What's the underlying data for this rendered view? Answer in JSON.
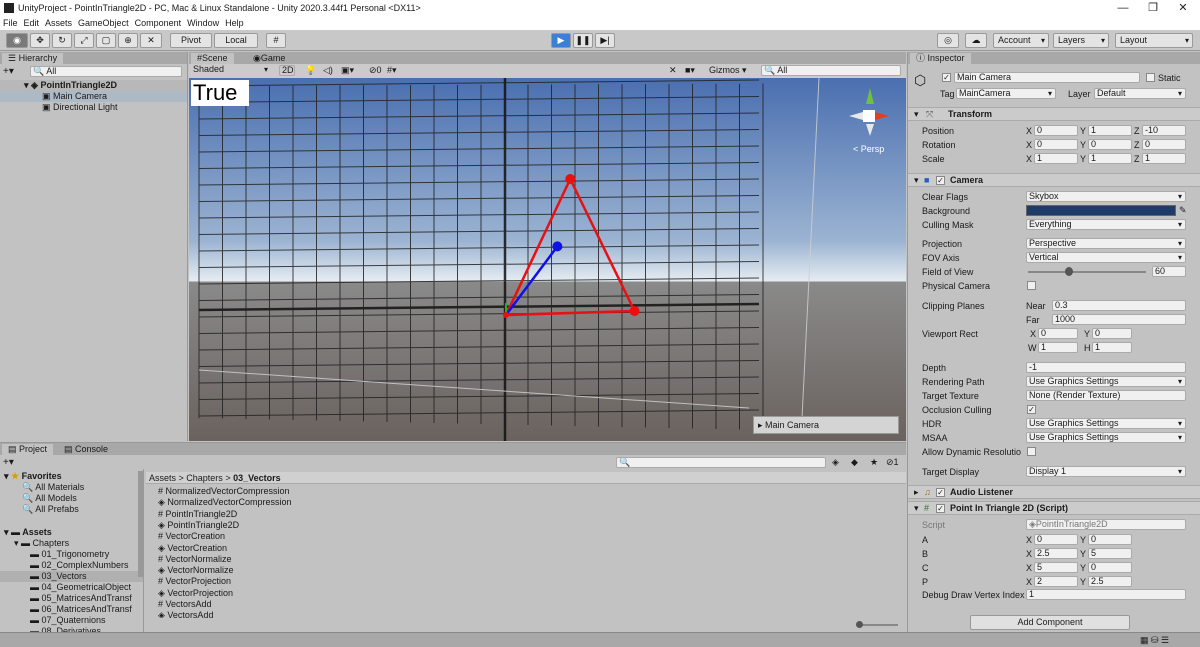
{
  "window": {
    "title": "UnityProject - PointInTriangle2D - PC, Mac & Linux Standalone - Unity 2020.3.44f1 Personal <DX11>",
    "minimize": "—",
    "maximize": "❐",
    "close": "✕"
  },
  "menu": [
    "File",
    "Edit",
    "Assets",
    "GameObject",
    "Component",
    "Window",
    "Help"
  ],
  "toolbar": {
    "pivot": "Pivot",
    "local": "Local",
    "account": "Account",
    "layers": "Layers",
    "layout": "Layout"
  },
  "hierarchy": {
    "tab": "Hierarchy",
    "search": "All",
    "scene": "PointInTriangle2D",
    "items": [
      "Main Camera",
      "Directional Light"
    ]
  },
  "scene": {
    "tabs": [
      "Scene",
      "Game"
    ],
    "shading": "Shaded",
    "mode2d": "2D",
    "fx": "0",
    "gizmos": "Gizmos",
    "search": "All",
    "overlay_text": "True",
    "persp": "< Persp",
    "camera_preview": "Main Camera"
  },
  "chart_data": {
    "type": "scatter",
    "x": [
      0,
      2.5,
      5,
      2
    ],
    "y": [
      0,
      5,
      0,
      2.5
    ],
    "points": [
      {
        "x": 0,
        "y": 0,
        "label": "A"
      },
      {
        "x": 2.5,
        "y": 5,
        "label": "B"
      },
      {
        "x": 5,
        "y": 0,
        "label": "C"
      },
      {
        "x": 2,
        "y": 2.5,
        "label": "P"
      }
    ],
    "triangle": [
      "A",
      "B",
      "C"
    ],
    "title": "",
    "xlabel": "",
    "ylabel": ""
  },
  "inspector": {
    "tab": "Inspector",
    "name": "Main Camera",
    "static": "Static",
    "tag_label": "Tag",
    "tag": "MainCamera",
    "layer_label": "Layer",
    "layer": "Default",
    "transform": {
      "title": "Transform",
      "rows": [
        {
          "label": "Position",
          "x": "0",
          "y": "1",
          "z": "-10"
        },
        {
          "label": "Rotation",
          "x": "0",
          "y": "0",
          "z": "0"
        },
        {
          "label": "Scale",
          "x": "1",
          "y": "1",
          "z": "1"
        }
      ]
    },
    "camera": {
      "title": "Camera",
      "clear_flags_label": "Clear Flags",
      "clear_flags": "Skybox",
      "background_label": "Background",
      "culling_label": "Culling Mask",
      "culling": "Everything",
      "projection_label": "Projection",
      "projection": "Perspective",
      "fov_axis_label": "FOV Axis",
      "fov_axis": "Vertical",
      "fov_label": "Field of View",
      "fov": "60",
      "physical_label": "Physical Camera",
      "clipping_label": "Clipping Planes",
      "near_label": "Near",
      "near": "0.3",
      "far_label": "Far",
      "far": "1000",
      "viewport_label": "Viewport Rect",
      "vx": "0",
      "vy": "0",
      "vw": "1",
      "vh": "1",
      "depth_label": "Depth",
      "depth": "-1",
      "render_path_label": "Rendering Path",
      "render_path": "Use Graphics Settings",
      "target_tex_label": "Target Texture",
      "target_tex": "None (Render Texture)",
      "occlusion_label": "Occlusion Culling",
      "hdr_label": "HDR",
      "hdr": "Use Graphics Settings",
      "msaa_label": "MSAA",
      "msaa": "Use Graphics Settings",
      "dyn_res_label": "Allow Dynamic Resolutio",
      "target_display_label": "Target Display",
      "target_display": "Display 1"
    },
    "audio": {
      "title": "Audio Listener"
    },
    "script": {
      "title": "Point In Triangle 2D (Script)",
      "script_label": "Script",
      "script": "PointInTriangle2D",
      "rows": [
        {
          "label": "A",
          "x": "0",
          "y": "0"
        },
        {
          "label": "B",
          "x": "2.5",
          "y": "5"
        },
        {
          "label": "C",
          "x": "5",
          "y": "0"
        },
        {
          "label": "P",
          "x": "2",
          "y": "2.5"
        }
      ],
      "debug_label": "Debug Draw Vertex Index",
      "debug": "1"
    },
    "add_component": "Add Component"
  },
  "project": {
    "tabs": [
      "Project",
      "Console"
    ],
    "favorites": "Favorites",
    "fav_items": [
      "All Materials",
      "All Models",
      "All Prefabs"
    ],
    "assets": "Assets",
    "chapters": "Chapters",
    "chapter_items": [
      "01_Trigonometry",
      "02_ComplexNumbers",
      "03_Vectors",
      "04_GeometricalObject",
      "05_MatricesAndTransf",
      "06_MatricesAndTransf",
      "07_Quaternions",
      "08_Derivatives"
    ],
    "breadcrumb": [
      "Assets",
      "Chapters",
      "03_Vectors"
    ],
    "files": [
      "NormalizedVectorCompression",
      "NormalizedVectorCompression",
      "PointInTriangle2D",
      "PointInTriangle2D",
      "VectorCreation",
      "VectorCreation",
      "VectorNormalize",
      "VectorNormalize",
      "VectorProjection",
      "VectorProjection",
      "VectorsAdd",
      "VectorsAdd"
    ],
    "count": "1"
  }
}
